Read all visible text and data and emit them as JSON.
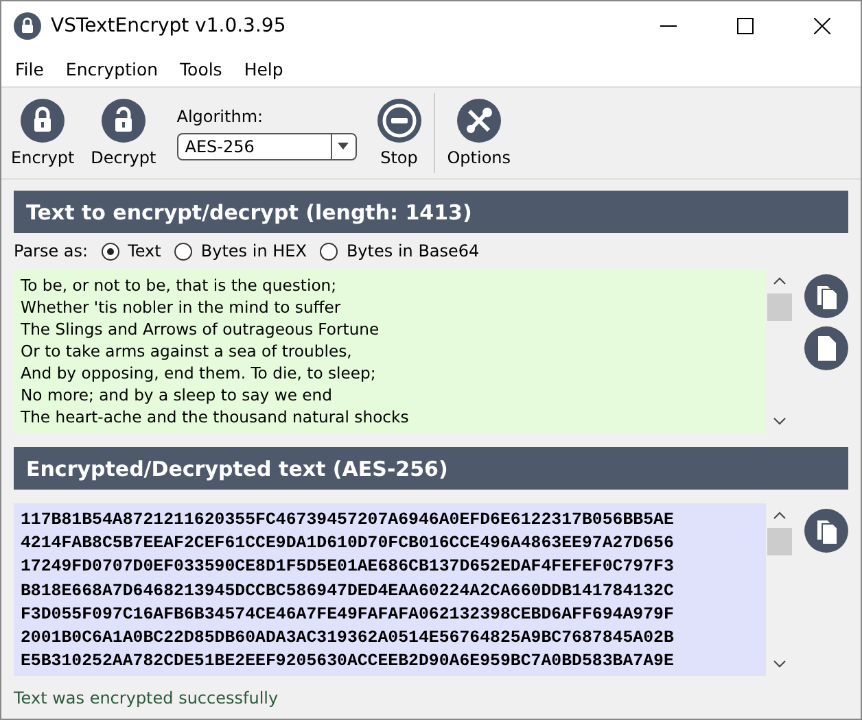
{
  "window": {
    "title": "VSTextEncrypt v1.0.3.95"
  },
  "menu": [
    "File",
    "Encryption",
    "Tools",
    "Help"
  ],
  "toolbar": {
    "encrypt": "Encrypt",
    "decrypt": "Decrypt",
    "algorithm_label": "Algorithm:",
    "algorithm": "AES-256",
    "stop": "Stop",
    "options": "Options"
  },
  "input_panel": {
    "header": "Text to encrypt/decrypt (length: 1413)",
    "parse_label": "Parse as:",
    "parse_options": [
      {
        "label": "Text",
        "selected": true
      },
      {
        "label": "Bytes in HEX",
        "selected": false
      },
      {
        "label": "Bytes in Base64",
        "selected": false
      }
    ],
    "lines": [
      "To be, or not to be, that is the question;",
      "Whether 'tis nobler in the mind to suffer",
      "The Slings and Arrows of outrageous Fortune",
      "Or to take arms against a sea of troubles,",
      "And by opposing, end them. To die, to sleep;",
      "No more; and by a sleep to say we end",
      "The heart-ache and the thousand natural shocks"
    ]
  },
  "output_panel": {
    "header": "Encrypted/Decrypted text (AES-256)",
    "lines": [
      "117B81B54A8721211620355FC46739457207A6946A0EFD6E6122317B056BB5AE",
      "4214FAB8C5B7EEAF2CEF61CCE9DA1D610D70FCB016CCE496A4863EE97A27D656",
      "17249FD0707D0EF033590CE8D1F5D5E01AE686CB137D652EDAF4FEFEF0C797F3",
      "B818E668A7D6468213945DCCBC586947DED4EAA60224A2CA660DDB141784132C",
      "F3D055F097C16AFB6B34574CE46A7FE49FAFAFA062132398CEBD6AFF694A979F",
      "2001B0C6A1A0BC22D85DB60ADA3AC319362A0514E56764825A9BC7687845A02B",
      "E5B310252AA782CDE51BE2EEF9205630ACCEEB2D90A6E959BC7A0BD583BA7A9E"
    ]
  },
  "status_bar": "Text was encrypted successfully"
}
